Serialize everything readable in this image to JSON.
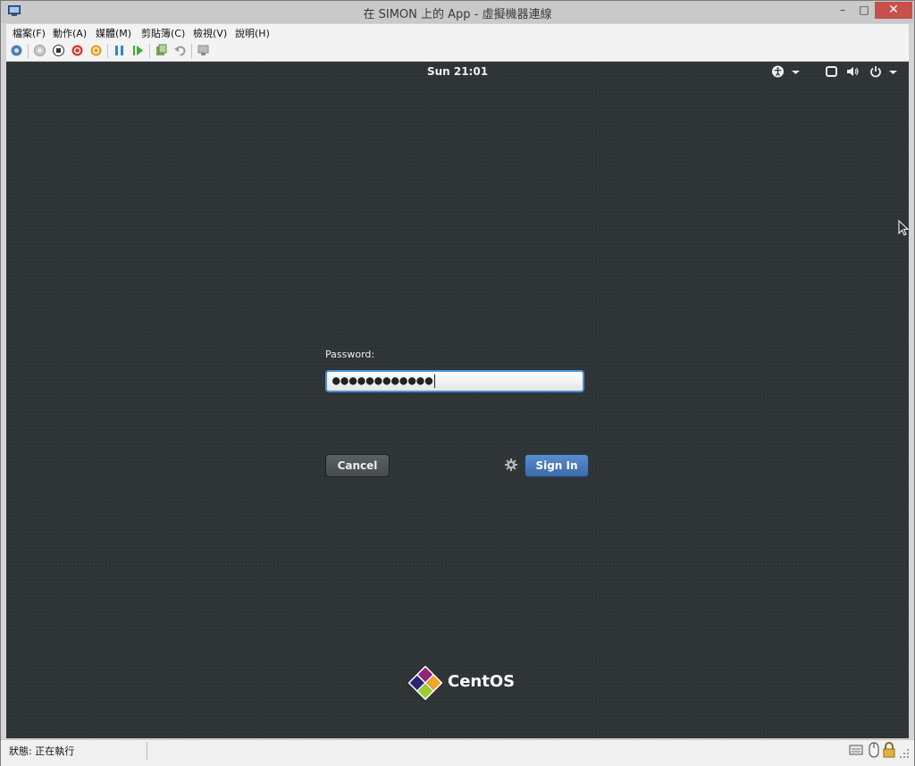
{
  "window": {
    "title": "在 SIMON 上的 App - 虛擬機器連線",
    "minimize_glyph": "–",
    "maximize_glyph": "□",
    "close_glyph": "✕"
  },
  "menu": {
    "items": [
      {
        "label": "檔案(F)"
      },
      {
        "label": "動作(A)"
      },
      {
        "label": "媒體(M)"
      },
      {
        "label": "剪貼簿(C)"
      },
      {
        "label": "檢視(V)"
      },
      {
        "label": "說明(H)"
      }
    ]
  },
  "toolbar": {
    "icons": [
      "ctrl-alt-del-icon",
      "start-icon",
      "turn-off-icon",
      "shut-down-icon",
      "save-icon",
      "pause-icon",
      "resume-icon",
      "checkpoint-icon",
      "revert-icon",
      "enhanced-session-icon"
    ]
  },
  "vm": {
    "top_bar": {
      "clock": "Sun 21:01",
      "icons": [
        "accessibility-icon",
        "dropdown-arrow-icon",
        "display-icon",
        "volume-icon",
        "power-icon",
        "dropdown-arrow-icon"
      ]
    },
    "login": {
      "password_label": "Password:",
      "password_value": "●●●●●●●●●●●●",
      "cancel_label": "Cancel",
      "sign_in_label": "Sign In"
    },
    "brand": {
      "logo_text": "CentOS"
    }
  },
  "status_bar": {
    "status_text": "狀態: 正在執行"
  },
  "colors": {
    "vm_background": "#2e3436",
    "sign_in_button": "#4a7bbf",
    "input_focus_border": "#4a90d9",
    "close_button": "#c7504b"
  }
}
